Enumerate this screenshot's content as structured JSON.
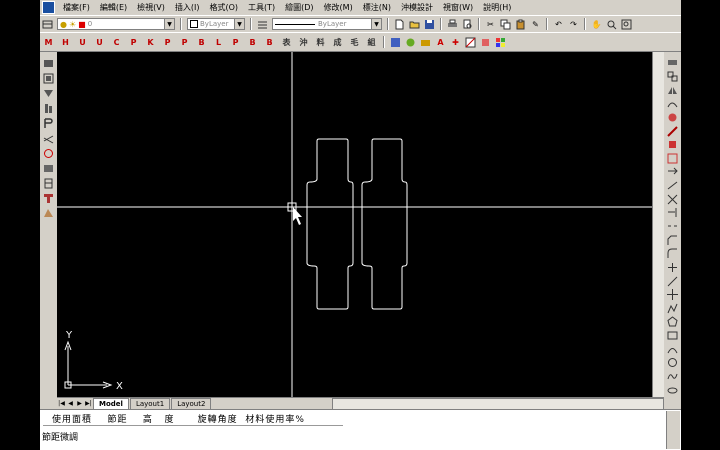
{
  "menu": {
    "items": [
      "檔案(F)",
      "編輯(E)",
      "檢視(V)",
      "插入(I)",
      "格式(O)",
      "工具(T)",
      "繪圖(D)",
      "修改(M)",
      "標注(N)",
      "沖模設計",
      "視窗(W)",
      "說明(H)"
    ]
  },
  "toolbar1": {
    "layer_value": "0",
    "color_value": "ByLayer",
    "linetype_value": "ByLayer",
    "icons": [
      "new-icon",
      "open-icon",
      "save-icon",
      "print-icon",
      "preview-icon",
      "cut-icon",
      "copy-icon",
      "paste-icon",
      "match-icon",
      "undo-icon",
      "redo-icon",
      "pan-icon",
      "zoom-icon",
      "zoom-window-icon"
    ]
  },
  "toolbar2": {
    "buttons": [
      "M",
      "H",
      "U",
      "U",
      "C",
      "P",
      "K",
      "P",
      "P",
      "B",
      "L",
      "P",
      "B",
      "B",
      "表",
      "沖",
      "料",
      "成",
      "毛",
      "組"
    ],
    "extra_icons": [
      "layer-state-icon",
      "layer-off-icon",
      "layer-freeze-icon",
      "text-style-icon",
      "dim-style-icon",
      "hatch-icon",
      "block-icon",
      "color-grid-icon"
    ]
  },
  "left_toolbar": {
    "icons": [
      "tool-1-icon",
      "tool-2-icon",
      "tool-3-icon",
      "tool-4-icon",
      "tool-5-icon",
      "tool-6-icon",
      "tool-7-icon",
      "tool-8-icon",
      "tool-9-icon",
      "tool-10-icon",
      "tool-11-icon"
    ]
  },
  "right_toolbar": {
    "icons": [
      "erase-icon",
      "copy-object-icon",
      "mirror-icon",
      "offset-icon",
      "array-icon",
      "move-icon",
      "rotate-icon",
      "scale-icon",
      "stretch-icon",
      "lengthen-icon",
      "trim-icon",
      "extend-icon",
      "break-icon",
      "chamfer-icon",
      "fillet-icon",
      "explode-icon",
      "line-icon",
      "xline-icon",
      "pline-icon",
      "polygon-icon",
      "rectangle-icon",
      "arc-icon",
      "circle-icon",
      "spline-icon",
      "ellipse-icon"
    ]
  },
  "canvas": {
    "ucs_y": "Y",
    "ucs_x": "X"
  },
  "tabs": [
    "Model",
    "Layout1",
    "Layout2"
  ],
  "command": {
    "line1": "使用面積    節距    高   度      旋轉角度  材料使用率%",
    "line2": "節距微調"
  },
  "colors": {
    "ui_gray": "#d4d0c8",
    "canvas": "#000000",
    "drawing_line": "#ffffff"
  }
}
